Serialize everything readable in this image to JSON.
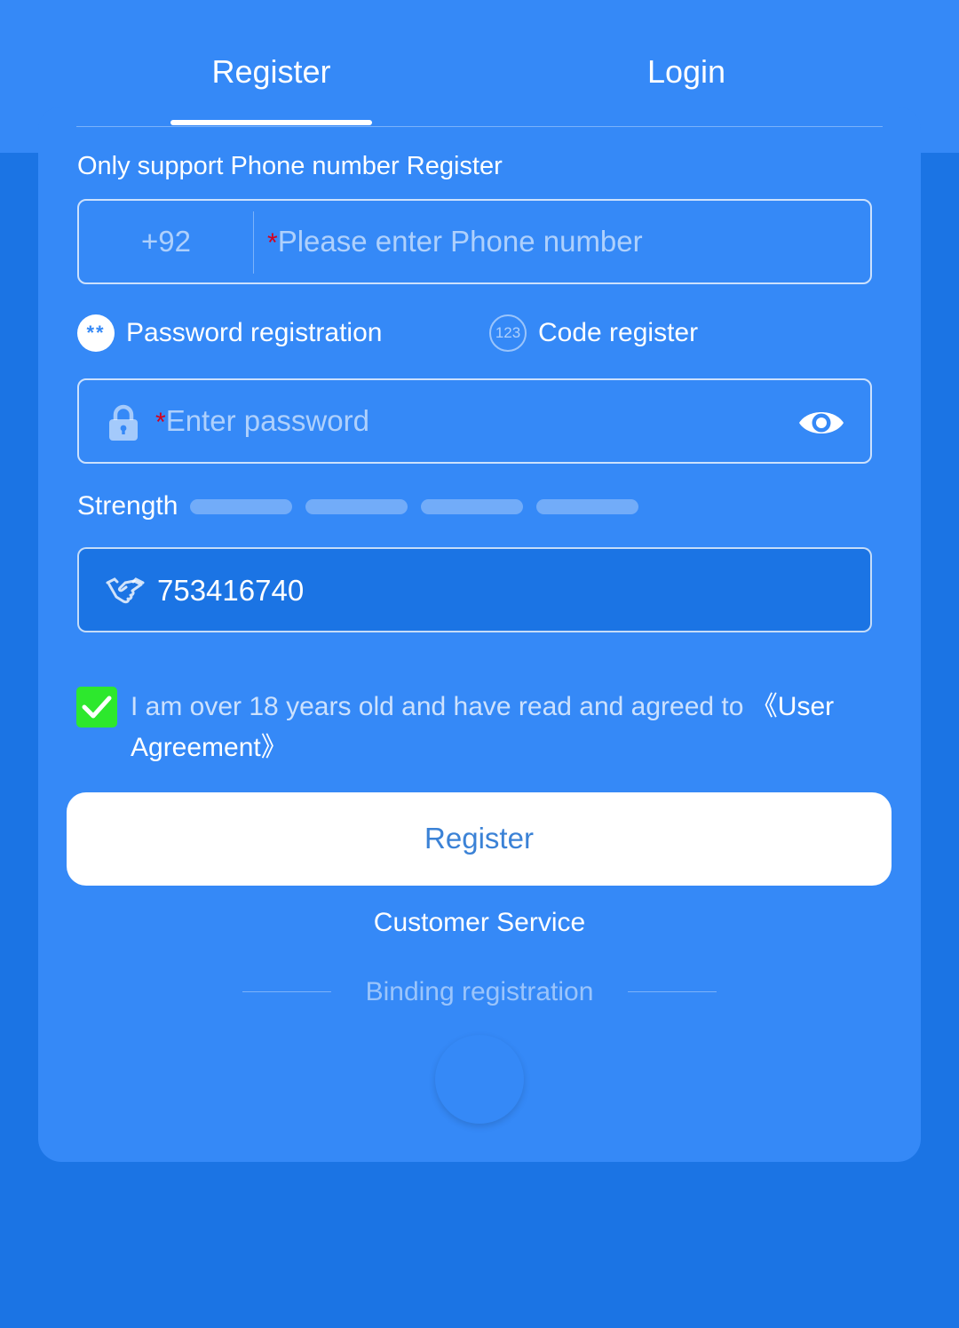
{
  "tabs": {
    "register": "Register",
    "login": "Login"
  },
  "hint": "Only support Phone number Register",
  "phone": {
    "country_code": "+92",
    "required_mark": "*",
    "placeholder": "Please enter Phone number"
  },
  "modes": {
    "password_icon_text": "**",
    "password_label": "Password registration",
    "code_icon_text": "123",
    "code_label": "Code register"
  },
  "password": {
    "required_mark": "*",
    "placeholder": "Enter password",
    "icon": "lock-icon",
    "toggle_icon": "eye-icon"
  },
  "strength": {
    "label": "Strength",
    "level": 0,
    "segments": 4
  },
  "invite": {
    "icon": "handshake-icon",
    "value": "753416740"
  },
  "agreement": {
    "checked": true,
    "text": "I am over 18 years old and have read and agreed to ",
    "link": "《User Agreement》"
  },
  "register_button": "Register",
  "customer_service": "Customer Service",
  "binding": {
    "label": "Binding registration"
  },
  "colors": {
    "page_bg": "#1b74e4",
    "card_bg": "#3589f7",
    "checkbox_green": "#2de82d",
    "required_red": "#d6001c",
    "button_text": "#3b82d6"
  }
}
